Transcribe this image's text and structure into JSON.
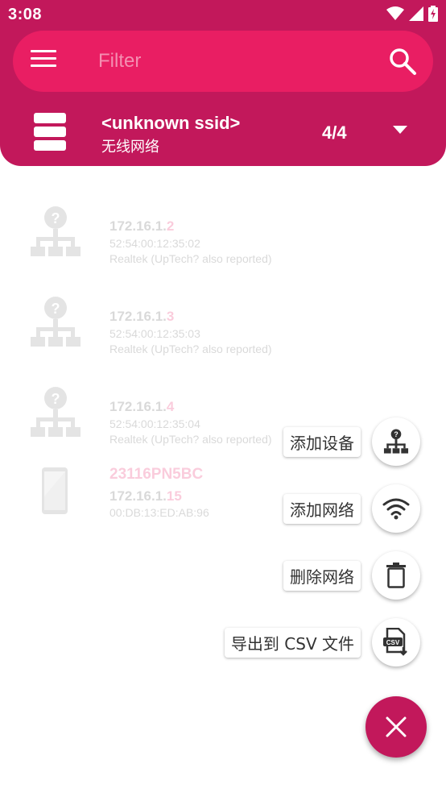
{
  "status_bar": {
    "time": "3:08"
  },
  "search": {
    "placeholder": "Filter"
  },
  "network": {
    "ssid": "<unknown ssid>",
    "subtitle": "无线网络",
    "count": "4/4"
  },
  "devices": [
    {
      "ip_prefix": "172.16.1.",
      "ip_last": "2",
      "mac": "52:54:00:12:35:02",
      "vendor": "Realtek (UpTech? also reported)",
      "icon": "unknown-network-device-icon"
    },
    {
      "ip_prefix": "172.16.1.",
      "ip_last": "3",
      "mac": "52:54:00:12:35:03",
      "vendor": "Realtek (UpTech? also reported)",
      "icon": "unknown-network-device-icon"
    },
    {
      "ip_prefix": "172.16.1.",
      "ip_last": "4",
      "mac": "52:54:00:12:35:04",
      "vendor": "Realtek (UpTech? also reported)",
      "icon": "unknown-network-device-icon"
    },
    {
      "hostname": "23116PN5BC",
      "ip_prefix": "172.16.1.",
      "ip_last": "15",
      "mac": "00:DB:13:ED:AB:96",
      "icon": "phone-icon"
    }
  ],
  "fab_menu": {
    "add_device": "添加设备",
    "add_network": "添加网络",
    "delete_network": "删除网络",
    "export_csv": "导出到 CSV 文件"
  },
  "colors": {
    "primary": "#c2185b",
    "accent": "#e91e63",
    "background": "#ffffff"
  }
}
